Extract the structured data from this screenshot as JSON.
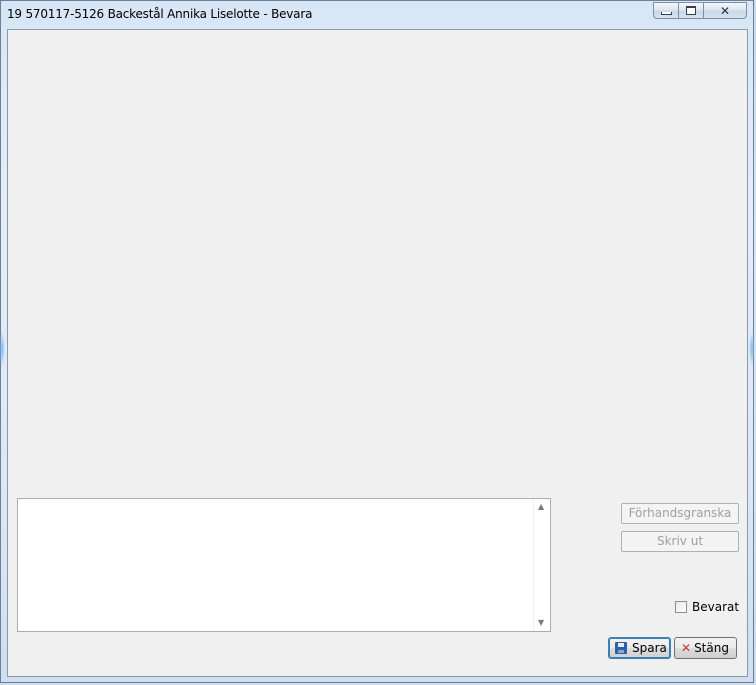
{
  "window": {
    "title": "19 570117-5126 Backestål Annika Liselotte - Bevara"
  },
  "caption_buttons": {
    "minimize_icon": "minimize-icon",
    "maximize_icon": "maximize-icon",
    "close_icon": "close-icon",
    "close_glyph": "✕"
  },
  "memo": {
    "value": "",
    "scroll_up": "▲",
    "scroll_down": "▼"
  },
  "actions": {
    "preview_label": "Förhandsgranska",
    "print_label": "Skriv ut",
    "bevarat_label": "Bevarat",
    "bevarat_checked": false,
    "save_label": "Spara",
    "close_label": "Stäng",
    "close_x": "✕"
  },
  "colors": {
    "client_bg": "#f0f0f0",
    "disabled_text": "#a0a0a0",
    "focus_border": "#3c7fb1"
  }
}
